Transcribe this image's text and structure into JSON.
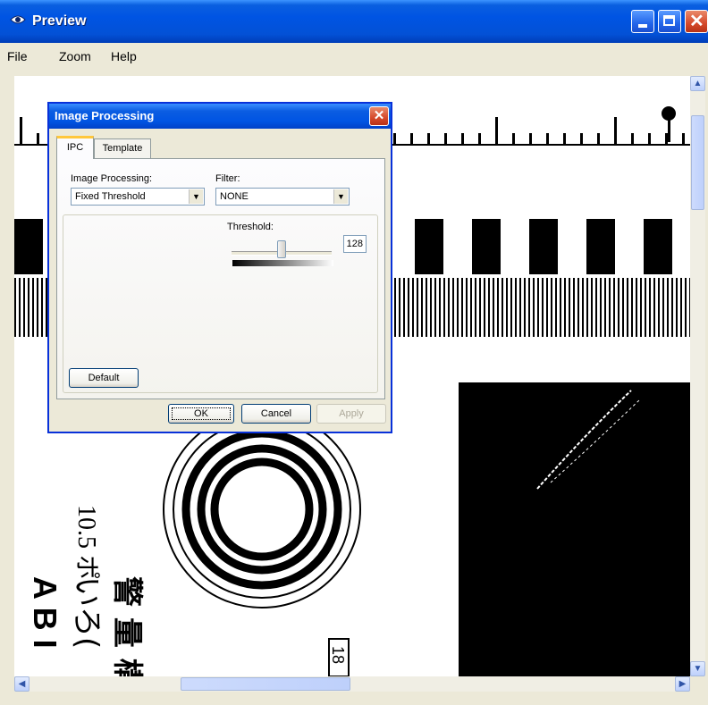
{
  "window": {
    "title": "Preview",
    "colors": {
      "title_bar": "#0054e3",
      "close_button": "#d5492b"
    }
  },
  "menu": {
    "items": [
      "File",
      "Zoom",
      "Help"
    ]
  },
  "preview": {
    "image_text_vertical_left": "10.5 ポ",
    "image_text_vertical_2": "A B I",
    "image_text_vertical_3": "いろ(",
    "image_text_vertical_4": "警 量 構",
    "image_text_boxed": "18"
  },
  "dialog": {
    "title": "Image Processing",
    "tabs": [
      {
        "label": "IPC",
        "selected": true
      },
      {
        "label": "Template",
        "selected": false
      }
    ],
    "image_processing_label": "Image Processing:",
    "image_processing_value": "Fixed Threshold",
    "filter_label": "Filter:",
    "filter_value": "NONE",
    "threshold_label": "Threshold:",
    "threshold_value": "128",
    "threshold_level": 0.5,
    "buttons": {
      "default": "Default",
      "ok": "OK",
      "cancel": "Cancel",
      "apply": "Apply"
    }
  }
}
